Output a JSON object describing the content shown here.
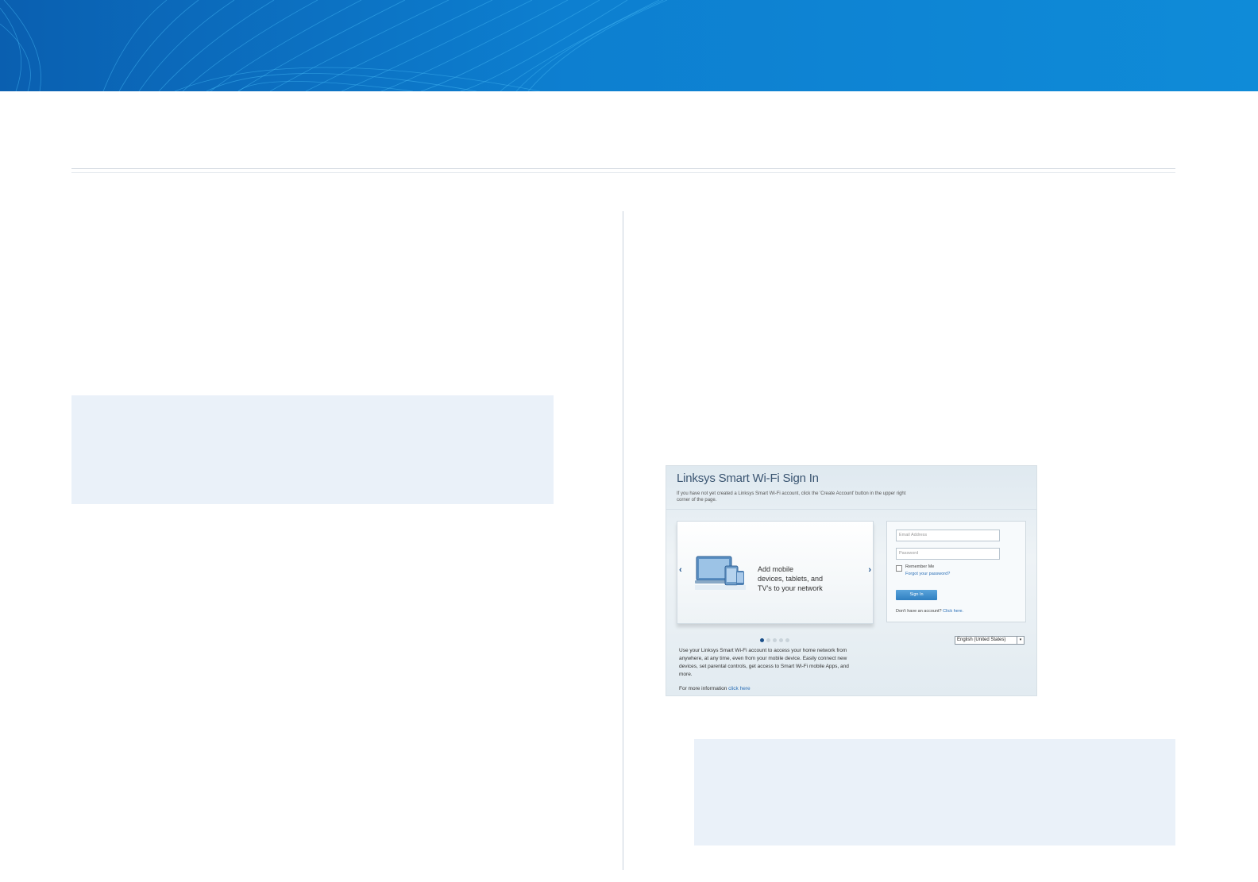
{
  "screenshot": {
    "title": "Linksys Smart Wi-Fi Sign In",
    "subtitle": "If you have not yet created a Linksys Smart Wi-Fi account, click the 'Create Account' button in the upper right corner of the page.",
    "carousel": {
      "prev_glyph": "‹",
      "next_glyph": "›",
      "text_line1": "Add mobile",
      "text_line2": "devices, tablets, and",
      "text_line3": "TV's to your network",
      "slide_count": 5,
      "active_slide": 1
    },
    "form": {
      "email_placeholder": "Email Address",
      "password_placeholder": "Password",
      "remember_label": "Remember Me",
      "forgot_link": "Forgot your password?",
      "signin_label": "Sign In",
      "no_account_text": "Don't have an account?",
      "click_here": "Click here."
    },
    "language": "English (United States)",
    "description": "Use your Linksys Smart Wi-Fi account to access your home network from anywhere, at any time, even from your mobile device. Easily connect new devices, set parental controls, get access to Smart Wi-Fi mobile Apps, and more.",
    "more_info_label": "For more information",
    "more_info_link": "click here"
  },
  "icons": [
    "devices-icon",
    "chevron-left-icon",
    "chevron-right-icon",
    "dropdown-arrow-icon"
  ]
}
